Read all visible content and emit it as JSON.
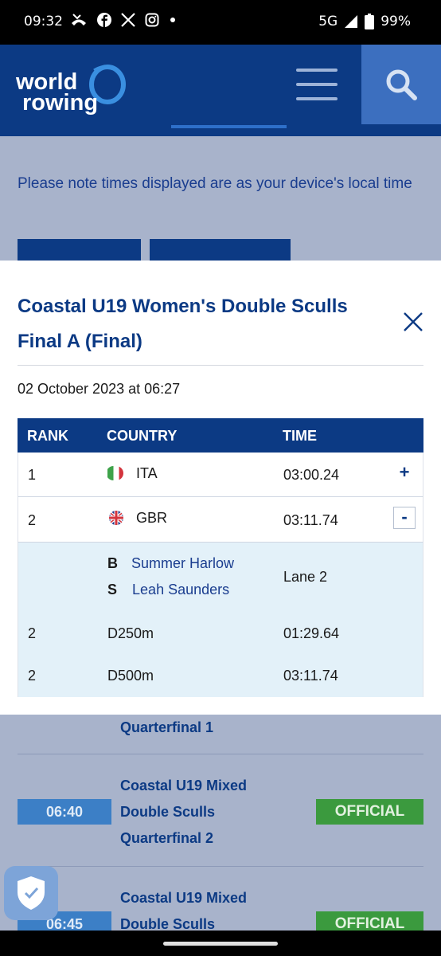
{
  "status_bar": {
    "time": "09:32",
    "icons": [
      "missed-call-icon",
      "facebook-icon",
      "x-icon",
      "instagram-icon",
      "dot-icon"
    ],
    "network": "5G",
    "battery": "99%"
  },
  "header": {
    "logo_line1": "world",
    "logo_line2": "rowing",
    "accent_color": "#0c3a84"
  },
  "background_page": {
    "note": "Please note times displayed are as your device's local time",
    "events": [
      {
        "name_line3": "Quarterfinal 1"
      },
      {
        "time": "06:40",
        "name_line1": "Coastal U19 Mixed",
        "name_line2": "Double Sculls",
        "name_line3": "Quarterfinal 2",
        "status": "OFFICIAL"
      },
      {
        "time": "06:45",
        "name_line1": "Coastal U19 Mixed",
        "name_line2": "Double Sculls",
        "status": "OFFICIAL"
      }
    ]
  },
  "modal": {
    "title_line1": "Coastal U19 Women's Double Sculls",
    "title_line2": "Final A (Final)",
    "date": "02 October 2023 at 06:27",
    "columns": {
      "rank": "RANK",
      "country": "COUNTRY",
      "time": "TIME"
    },
    "rows": [
      {
        "rank": "1",
        "country": "ITA",
        "time": "03:00.24",
        "toggle": "+"
      },
      {
        "rank": "2",
        "country": "GBR",
        "time": "03:11.74",
        "toggle": "-"
      }
    ],
    "expanded": {
      "crew": [
        {
          "position": "B",
          "name": "Summer Harlow"
        },
        {
          "position": "S",
          "name": "Leah Saunders"
        }
      ],
      "lane": "Lane 2",
      "splits": [
        {
          "rank": "2",
          "distance": "D250m",
          "time": "01:29.64"
        },
        {
          "rank": "2",
          "distance": "D500m",
          "time": "03:11.74"
        }
      ]
    }
  }
}
